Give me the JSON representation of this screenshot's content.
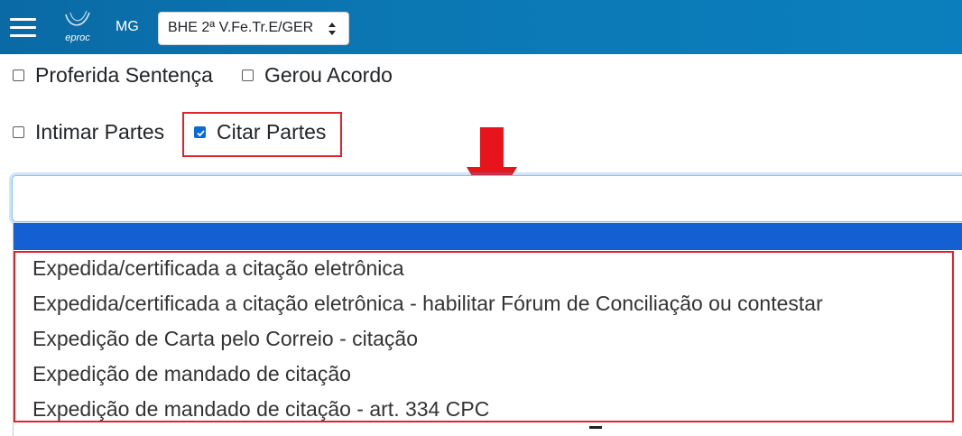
{
  "header": {
    "menu_icon": "hamburger-menu-icon",
    "logo_text": "eproc",
    "state": "MG",
    "unit_select": {
      "selected": "BHE 2ª V.Fe.Tr.E/GER",
      "icon": "select-caret-icon"
    }
  },
  "filters": {
    "row1": [
      {
        "label": "Proferida Sentença",
        "checked": false
      },
      {
        "label": "Gerou Acordo",
        "checked": false
      }
    ],
    "row2": [
      {
        "label": "Intimar Partes",
        "checked": false
      },
      {
        "label": "Citar Partes",
        "checked": true
      }
    ]
  },
  "search": {
    "value": "",
    "placeholder": ""
  },
  "dropdown": {
    "items": [
      "Expedida/certificada a citação eletrônica",
      "Expedida/certificada a citação eletrônica - habilitar Fórum de Conciliação ou contestar",
      "Expedição de Carta pelo Correio - citação",
      "Expedição de mandado de citação",
      "Expedição de mandado de citação - art. 334 CPC"
    ]
  },
  "annotations": {
    "highlight_color": "#e0232b",
    "arrow_icon": "down-arrow-icon"
  },
  "colors": {
    "topbar": "#0b78b4",
    "selected_option": "#1460d2",
    "checkbox_checked": "#0b6ad6"
  }
}
